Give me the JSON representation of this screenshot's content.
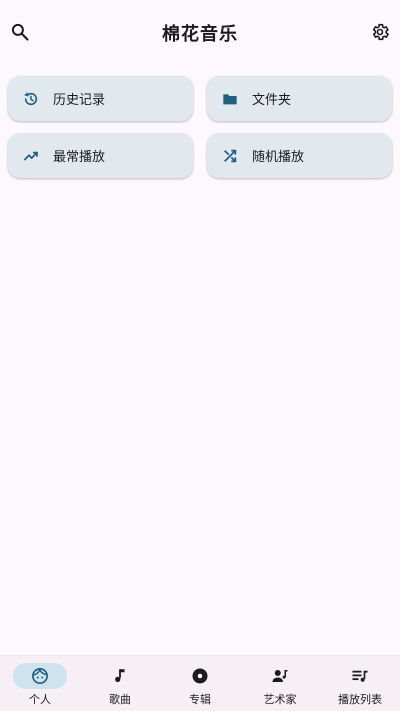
{
  "header": {
    "title": "棉花音乐",
    "search_icon": "search-icon",
    "settings_icon": "gear-icon"
  },
  "cards": [
    {
      "label": "历史记录",
      "icon": "history-icon"
    },
    {
      "label": "文件夹",
      "icon": "folder-icon"
    },
    {
      "label": "最常播放",
      "icon": "trending-up-icon"
    },
    {
      "label": "随机播放",
      "icon": "shuffle-icon"
    }
  ],
  "bottom_nav": [
    {
      "label": "个人",
      "icon": "face-icon",
      "active": true
    },
    {
      "label": "歌曲",
      "icon": "music-note-icon",
      "active": false
    },
    {
      "label": "专辑",
      "icon": "album-icon",
      "active": false
    },
    {
      "label": "艺术家",
      "icon": "artist-icon",
      "active": false
    },
    {
      "label": "播放列表",
      "icon": "playlist-icon",
      "active": false
    }
  ],
  "colors": {
    "accent": "#1e5f82",
    "card_bg": "#e1e8ee",
    "background": "#fdf8fd",
    "nav_active_pill": "#cfe3ee"
  }
}
